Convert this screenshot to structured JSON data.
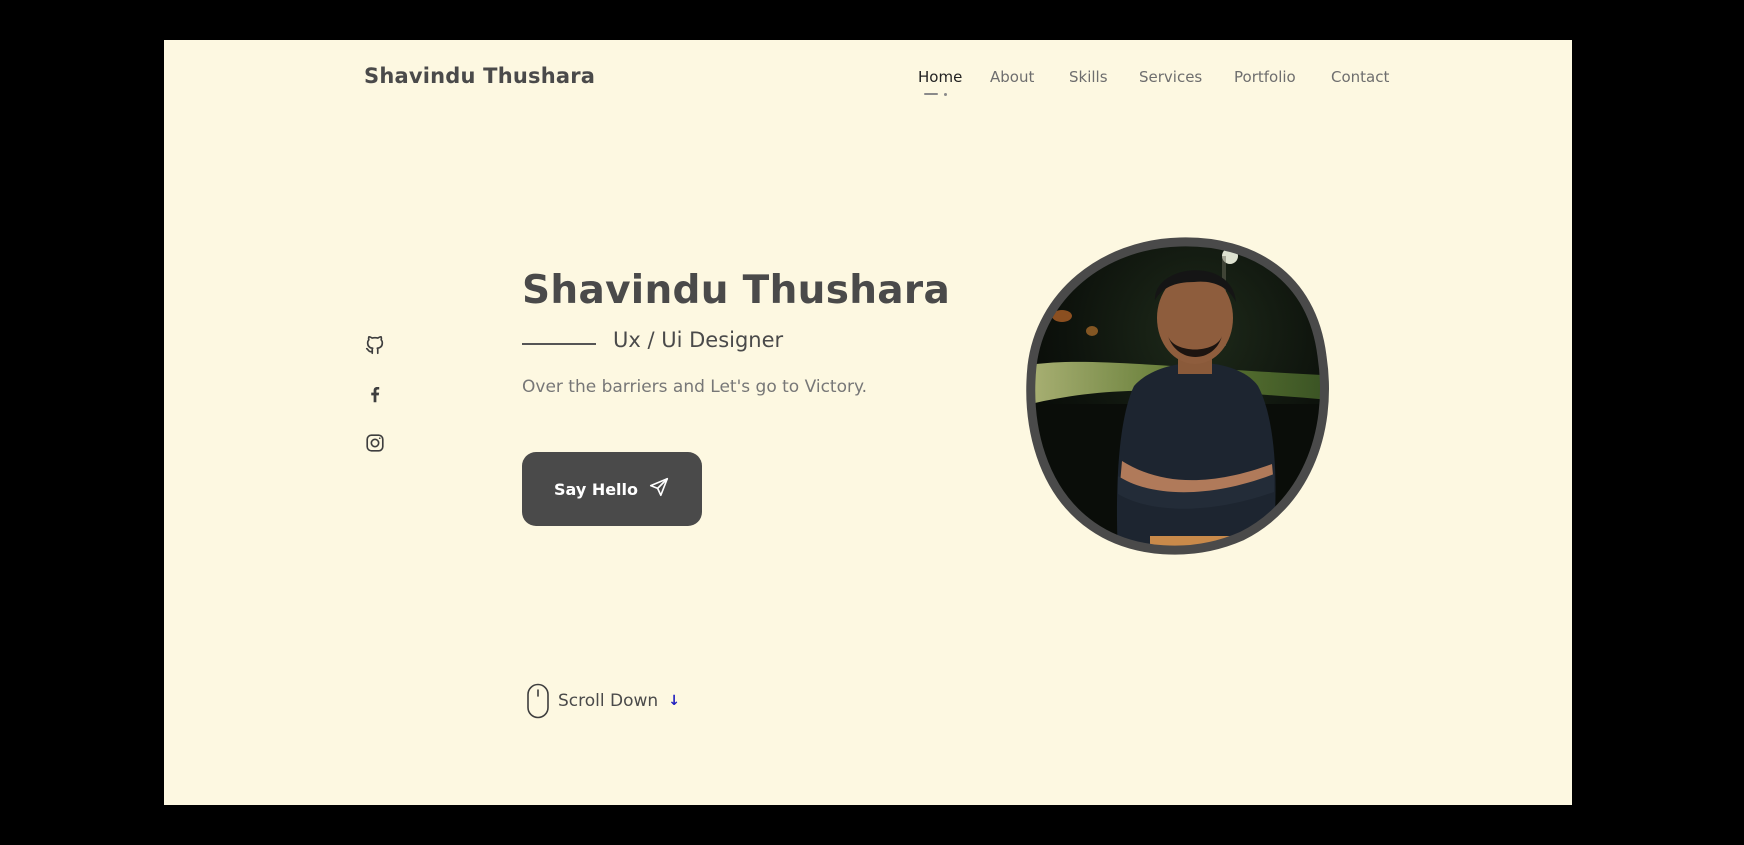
{
  "header": {
    "logo": "Shavindu Thushara",
    "nav": [
      {
        "label": "Home",
        "active": true
      },
      {
        "label": "About",
        "active": false
      },
      {
        "label": "Skills",
        "active": false
      },
      {
        "label": "Services",
        "active": false
      },
      {
        "label": "Portfolio",
        "active": false
      },
      {
        "label": "Contact",
        "active": false
      }
    ]
  },
  "social": [
    {
      "icon": "github-icon"
    },
    {
      "icon": "facebook-icon"
    },
    {
      "icon": "instagram-icon"
    }
  ],
  "hero": {
    "title": "Shavindu Thushara",
    "subtitle": "Ux / Ui Designer",
    "tagline": "Over the barriers and Let's go to Victory.",
    "button_label": "Say Hello",
    "button_icon": "send-icon"
  },
  "scroll": {
    "label": "Scroll Down",
    "icon": "mouse-icon",
    "arrow_icon": "arrow-down-icon",
    "arrow_glyph": "↓"
  },
  "colors": {
    "page_background": "#fdf8e1",
    "outer_background": "#000000",
    "text_dark": "#4a4a4a",
    "text_muted": "#777777",
    "button_background": "#4a4a4a",
    "accent_arrow": "#1f1fbf"
  }
}
